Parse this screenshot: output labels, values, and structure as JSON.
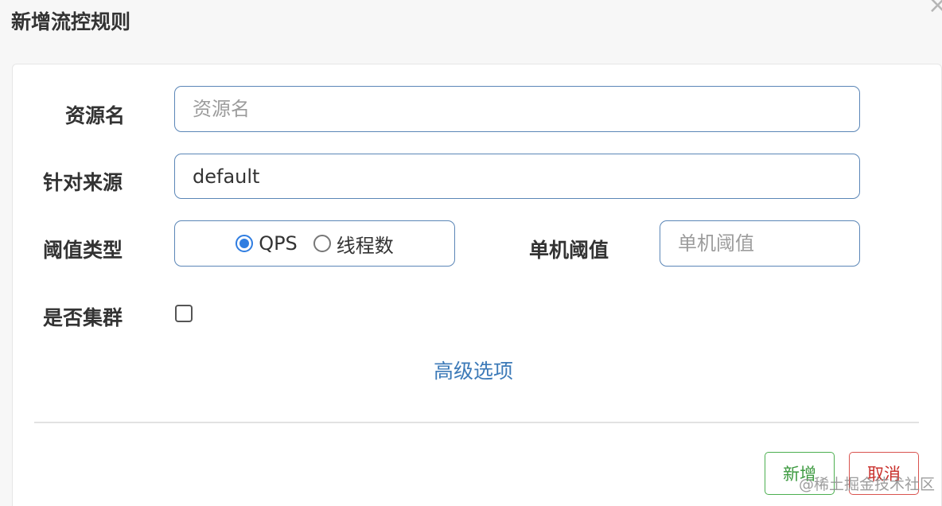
{
  "dialog": {
    "title": "新增流控规则",
    "close_icon": "close-icon"
  },
  "form": {
    "resource": {
      "label": "资源名",
      "placeholder": "资源名",
      "value": ""
    },
    "origin": {
      "label": "针对来源",
      "value": "default"
    },
    "threshold_type": {
      "label": "阈值类型",
      "options": [
        {
          "label": "QPS",
          "checked": true
        },
        {
          "label": "线程数",
          "checked": false
        }
      ]
    },
    "threshold": {
      "label": "单机阈值",
      "placeholder": "单机阈值",
      "value": ""
    },
    "cluster": {
      "label": "是否集群",
      "checked": false
    },
    "advanced_link": "高级选项"
  },
  "footer": {
    "add_label": "新增",
    "cancel_label": "取消"
  },
  "watermark": "@稀土掘金技术社区",
  "colors": {
    "border": "#5b86b7",
    "radio_checked": "#2f7de1",
    "link": "#3c7ab8",
    "add_button": "#3d9a40",
    "cancel_button": "#c9302c"
  }
}
